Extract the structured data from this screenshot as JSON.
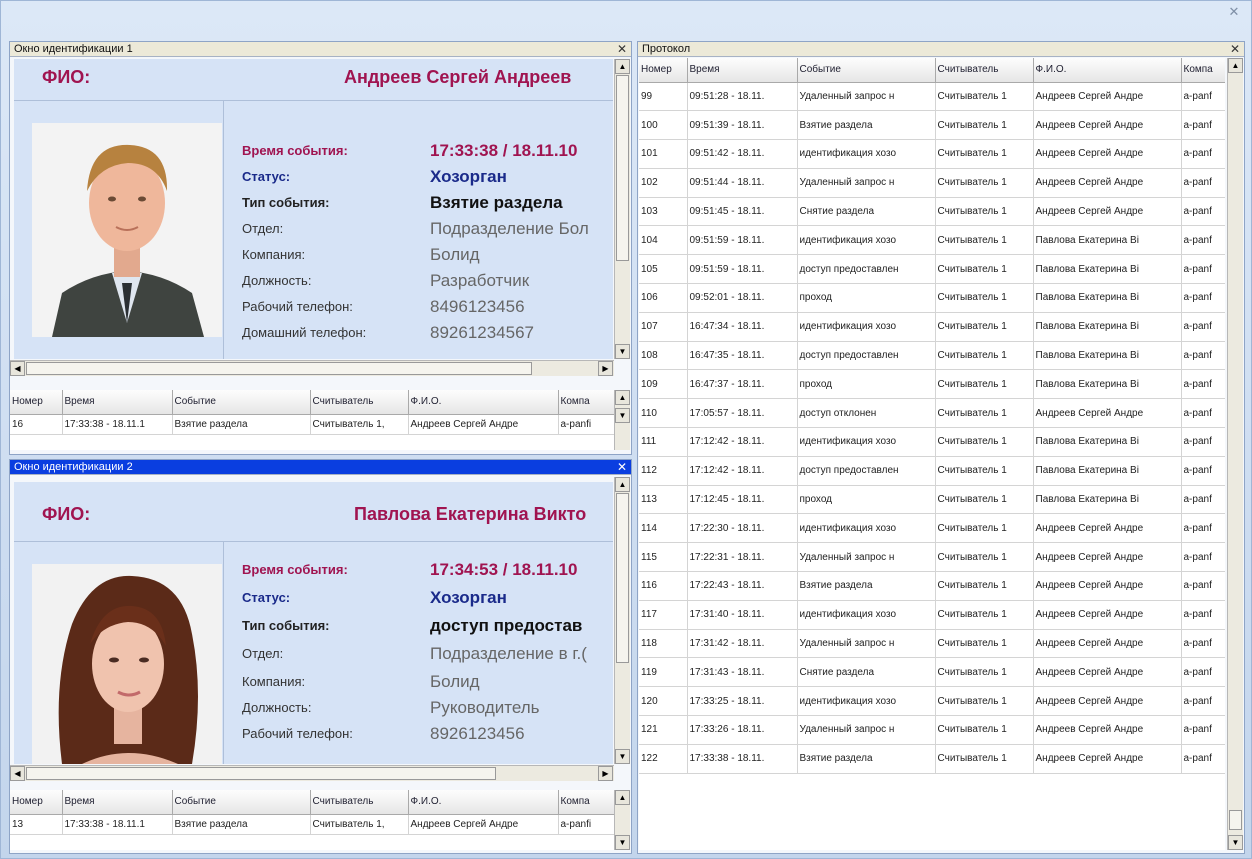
{
  "columns": [
    "Номер",
    "Время",
    "Событие",
    "Считыватель",
    "Ф.И.О.",
    "Компа"
  ],
  "win1": {
    "title": "Окно идентификации 1",
    "fio_label": "ФИО:",
    "fio_value": "Андреев Сергей Андреев",
    "fields": [
      {
        "label": "Время события:",
        "value": "17:33:38 / 18.11.10"
      },
      {
        "label": "Статус:",
        "value": "Хозорган"
      },
      {
        "label": "Тип события:",
        "value": "Взятие раздела"
      },
      {
        "label": "Отдел:",
        "value": "Подразделение Бол"
      },
      {
        "label": "Компания:",
        "value": "Болид"
      },
      {
        "label": "Должность:",
        "value": "Разработчик"
      },
      {
        "label": "Рабочий телефон:",
        "value": "8496123456"
      },
      {
        "label": "Домашний телефон:",
        "value": "89261234567"
      }
    ],
    "grid_header": [
      "Номер",
      "Время",
      "Событие",
      "Считыватель",
      "Ф.И.О.",
      "Компа"
    ],
    "grid_row": [
      "16",
      "17:33:38 - 18.11.1",
      "Взятие раздела",
      "Считыватель 1,",
      "Андреев Сергей Андре",
      "a-panfi"
    ]
  },
  "win2": {
    "title": "Окно идентификации 2",
    "fio_label": "ФИО:",
    "fio_value": "Павлова Екатерина Викто",
    "fields": [
      {
        "label": "Время события:",
        "value": "17:34:53 / 18.11.10"
      },
      {
        "label": "Статус:",
        "value": "Хозорган"
      },
      {
        "label": "Тип события:",
        "value": "доступ предостав"
      },
      {
        "label": "Отдел:",
        "value": "Подразделение в г.("
      },
      {
        "label": "Компания:",
        "value": "Болид"
      },
      {
        "label": "Должность:",
        "value": "Руководитель"
      },
      {
        "label": "Рабочий телефон:",
        "value": "8926123456"
      }
    ],
    "grid_header": [
      "Номер",
      "Время",
      "Событие",
      "Считыватель",
      "Ф.И.О.",
      "Компа"
    ],
    "grid_row": [
      "13",
      "17:33:38 - 18.11.1",
      "Взятие раздела",
      "Считыватель 1,",
      "Андреев Сергей Андре",
      "a-panfi"
    ]
  },
  "protocol": {
    "title": "Протокол",
    "header": [
      "Номер",
      "Время",
      "Событие",
      "Считыватель",
      "Ф.И.О.",
      "Компа"
    ],
    "rows": [
      [
        "99",
        "09:51:28 - 18.11.",
        "Удаленный запрос н",
        "Считыватель 1",
        "Андреев Сергей Андре",
        "a-panf"
      ],
      [
        "100",
        "09:51:39 - 18.11.",
        "Взятие раздела",
        "Считыватель 1",
        "Андреев Сергей Андре",
        "a-panf"
      ],
      [
        "101",
        "09:51:42 - 18.11.",
        "идентификация хозо",
        "Считыватель 1",
        "Андреев Сергей Андре",
        "a-panf"
      ],
      [
        "102",
        "09:51:44 - 18.11.",
        "Удаленный запрос н",
        "Считыватель 1",
        "Андреев Сергей Андре",
        "a-panf"
      ],
      [
        "103",
        "09:51:45 - 18.11.",
        "Снятие раздела",
        "Считыватель 1",
        "Андреев Сергей Андре",
        "a-panf"
      ],
      [
        "104",
        "09:51:59 - 18.11.",
        "идентификация хозо",
        "Считыватель 1",
        "Павлова Екатерина Ві",
        "a-panf"
      ],
      [
        "105",
        "09:51:59 - 18.11.",
        "доступ предоставлен",
        "Считыватель 1",
        "Павлова Екатерина Ві",
        "a-panf"
      ],
      [
        "106",
        "09:52:01 - 18.11.",
        "проход",
        "Считыватель 1",
        "Павлова Екатерина Ві",
        "a-panf"
      ],
      [
        "107",
        "16:47:34 - 18.11.",
        "идентификация хозо",
        "Считыватель 1",
        "Павлова Екатерина Ві",
        "a-panf"
      ],
      [
        "108",
        "16:47:35 - 18.11.",
        "доступ предоставлен",
        "Считыватель 1",
        "Павлова Екатерина Ві",
        "a-panf"
      ],
      [
        "109",
        "16:47:37 - 18.11.",
        "проход",
        "Считыватель 1",
        "Павлова Екатерина Ві",
        "a-panf"
      ],
      [
        "110",
        "17:05:57 - 18.11.",
        "доступ отклонен",
        "Считыватель 1",
        "Андреев Сергей Андре",
        "a-panf"
      ],
      [
        "111",
        "17:12:42 - 18.11.",
        "идентификация хозо",
        "Считыватель 1",
        "Павлова Екатерина Ві",
        "a-panf"
      ],
      [
        "112",
        "17:12:42 - 18.11.",
        "доступ предоставлен",
        "Считыватель 1",
        "Павлова Екатерина Ві",
        "a-panf"
      ],
      [
        "113",
        "17:12:45 - 18.11.",
        "проход",
        "Считыватель 1",
        "Павлова Екатерина Ві",
        "a-panf"
      ],
      [
        "114",
        "17:22:30 - 18.11.",
        "идентификация хозо",
        "Считыватель 1",
        "Андреев Сергей Андре",
        "a-panf"
      ],
      [
        "115",
        "17:22:31 - 18.11.",
        "Удаленный запрос н",
        "Считыватель 1",
        "Андреев Сергей Андре",
        "a-panf"
      ],
      [
        "116",
        "17:22:43 - 18.11.",
        "Взятие раздела",
        "Считыватель 1",
        "Андреев Сергей Андре",
        "a-panf"
      ],
      [
        "117",
        "17:31:40 - 18.11.",
        "идентификация хозо",
        "Считыватель 1",
        "Андреев Сергей Андре",
        "a-panf"
      ],
      [
        "118",
        "17:31:42 - 18.11.",
        "Удаленный запрос н",
        "Считыватель 1",
        "Андреев Сергей Андре",
        "a-panf"
      ],
      [
        "119",
        "17:31:43 - 18.11.",
        "Снятие раздела",
        "Считыватель 1",
        "Андреев Сергей Андре",
        "a-panf"
      ],
      [
        "120",
        "17:33:25 - 18.11.",
        "идентификация хозо",
        "Считыватель 1",
        "Андреев Сергей Андре",
        "a-panf"
      ],
      [
        "121",
        "17:33:26 - 18.11.",
        "Удаленный запрос н",
        "Считыватель 1",
        "Андреев Сергей Андре",
        "a-panf"
      ],
      [
        "122",
        "17:33:38 - 18.11.",
        "Взятие раздела",
        "Считыватель 1",
        "Андреев Сергей Андре",
        "a-panf"
      ]
    ]
  },
  "colors": {
    "accent_red": "#a01450",
    "accent_blue": "#1a2a8a",
    "active_title": "#0a3ee0",
    "card_bg": "#d6e3f6"
  }
}
